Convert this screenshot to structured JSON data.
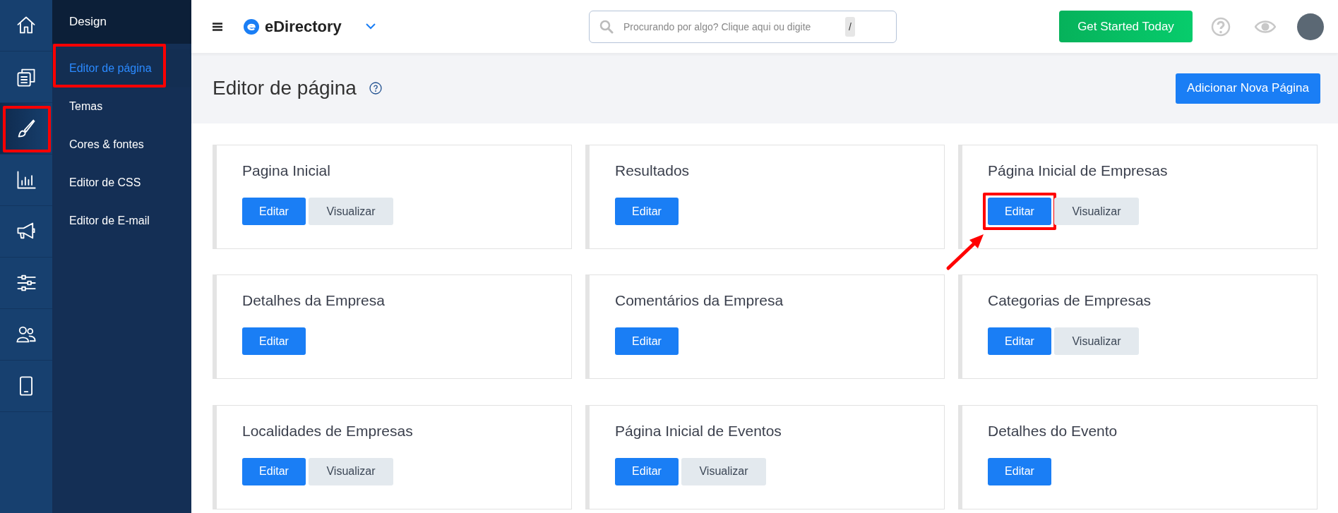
{
  "rail": [
    {
      "kind": "home",
      "selected": false,
      "highlighted": false
    },
    {
      "kind": "pages",
      "selected": false,
      "highlighted": false
    },
    {
      "kind": "brush",
      "selected": true,
      "highlighted": true
    },
    {
      "kind": "chart",
      "selected": false,
      "highlighted": false
    },
    {
      "kind": "megaphone",
      "selected": false,
      "highlighted": false
    },
    {
      "kind": "sliders",
      "selected": false,
      "highlighted": false
    },
    {
      "kind": "users",
      "selected": false,
      "highlighted": false
    },
    {
      "kind": "mobile",
      "selected": false,
      "highlighted": false
    }
  ],
  "submenu": {
    "title": "Design",
    "items": [
      {
        "label": "Editor de página",
        "selected": true,
        "highlighted": true
      },
      {
        "label": "Temas",
        "selected": false,
        "highlighted": false
      },
      {
        "label": "Cores & fontes",
        "selected": false,
        "highlighted": false
      },
      {
        "label": "Editor de CSS",
        "selected": false,
        "highlighted": false
      },
      {
        "label": "Editor de E-mail",
        "selected": false,
        "highlighted": false
      }
    ]
  },
  "topbar": {
    "brand": "eDirectory",
    "search": {
      "placeholder": "Procurando por algo? Clique aqui ou digite",
      "shortcut": "/"
    },
    "cta": "Get Started Today"
  },
  "header": {
    "title": "Editor de página",
    "button": "Adicionar Nova Página"
  },
  "cards": [
    {
      "title": "Pagina Inicial",
      "buttons": [
        {
          "label": "Editar",
          "kind": "primary",
          "highlighted": false
        },
        {
          "label": "Visualizar",
          "kind": "secondary",
          "highlighted": false
        }
      ]
    },
    {
      "title": "Resultados",
      "buttons": [
        {
          "label": "Editar",
          "kind": "primary",
          "highlighted": false
        }
      ]
    },
    {
      "title": "Página Inicial de Empresas",
      "buttons": [
        {
          "label": "Editar",
          "kind": "primary",
          "highlighted": true
        },
        {
          "label": "Visualizar",
          "kind": "secondary",
          "highlighted": false
        }
      ]
    },
    {
      "title": "Detalhes da Empresa",
      "buttons": [
        {
          "label": "Editar",
          "kind": "primary",
          "highlighted": false
        }
      ]
    },
    {
      "title": "Comentários da Empresa",
      "buttons": [
        {
          "label": "Editar",
          "kind": "primary",
          "highlighted": false
        }
      ]
    },
    {
      "title": "Categorias de Empresas",
      "buttons": [
        {
          "label": "Editar",
          "kind": "primary",
          "highlighted": false
        },
        {
          "label": "Visualizar",
          "kind": "secondary",
          "highlighted": false
        }
      ]
    },
    {
      "title": "Localidades de Empresas",
      "buttons": [
        {
          "label": "Editar",
          "kind": "primary",
          "highlighted": false
        },
        {
          "label": "Visualizar",
          "kind": "secondary",
          "highlighted": false
        }
      ]
    },
    {
      "title": "Página Inicial de Eventos",
      "buttons": [
        {
          "label": "Editar",
          "kind": "primary",
          "highlighted": false
        },
        {
          "label": "Visualizar",
          "kind": "secondary",
          "highlighted": false
        }
      ]
    },
    {
      "title": "Detalhes do Evento",
      "buttons": [
        {
          "label": "Editar",
          "kind": "primary",
          "highlighted": false
        }
      ]
    }
  ]
}
